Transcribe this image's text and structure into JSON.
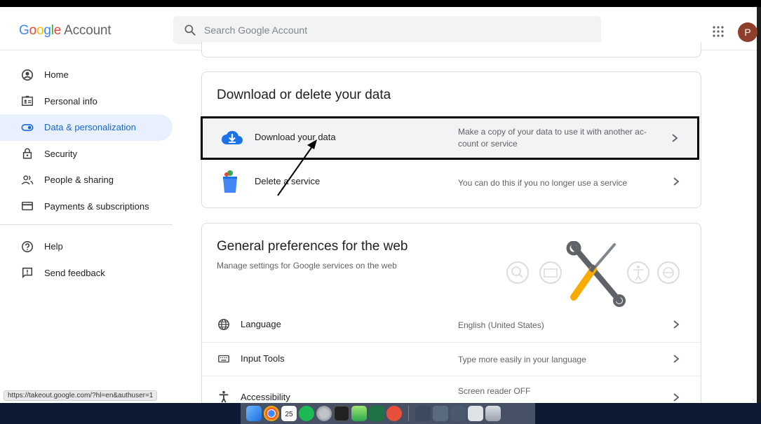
{
  "header": {
    "logo_google": [
      "G",
      "o",
      "o",
      "g",
      "l",
      "e"
    ],
    "logo_account": "Account",
    "search_placeholder": "Search Google Account",
    "avatar_letter": "P"
  },
  "sidebar": {
    "items": [
      {
        "label": "Home",
        "icon": "account-circle-icon"
      },
      {
        "label": "Personal info",
        "icon": "id-card-icon"
      },
      {
        "label": "Data & personalization",
        "icon": "toggle-icon",
        "active": true
      },
      {
        "label": "Security",
        "icon": "lock-icon"
      },
      {
        "label": "People & sharing",
        "icon": "people-icon"
      },
      {
        "label": "Payments & subscriptions",
        "icon": "credit-card-icon"
      }
    ],
    "secondary": [
      {
        "label": "Help",
        "icon": "help-icon"
      },
      {
        "label": "Send feedback",
        "icon": "feedback-icon"
      }
    ]
  },
  "download_card": {
    "title": "Download or delete your data",
    "rows": [
      {
        "label": "Download your data",
        "desc_line1": "Make a copy of your data to use it with another ac-",
        "desc_line2": "count or service"
      },
      {
        "label": "Delete a service",
        "desc": "You can do this if you no longer use a service"
      }
    ]
  },
  "general_card": {
    "title": "General preferences for the web",
    "subtitle": "Manage settings for Google services on the web",
    "rows": [
      {
        "label": "Language",
        "desc": "English (United States)",
        "icon": "globe-icon"
      },
      {
        "label": "Input Tools",
        "desc": "Type more easily in your language",
        "icon": "keyboard-icon"
      },
      {
        "label": "Accessibility",
        "desc": "Screen reader OFF",
        "icon": "accessibility-icon"
      }
    ]
  },
  "status_url": "https://takeout.google.com/?hl=en&authuser=1",
  "dock": {
    "calendar_day": "25"
  },
  "colors": {
    "accent": "#1967d2",
    "active_bg": "#e8f0fe",
    "avatar": "#8d3f2b"
  }
}
